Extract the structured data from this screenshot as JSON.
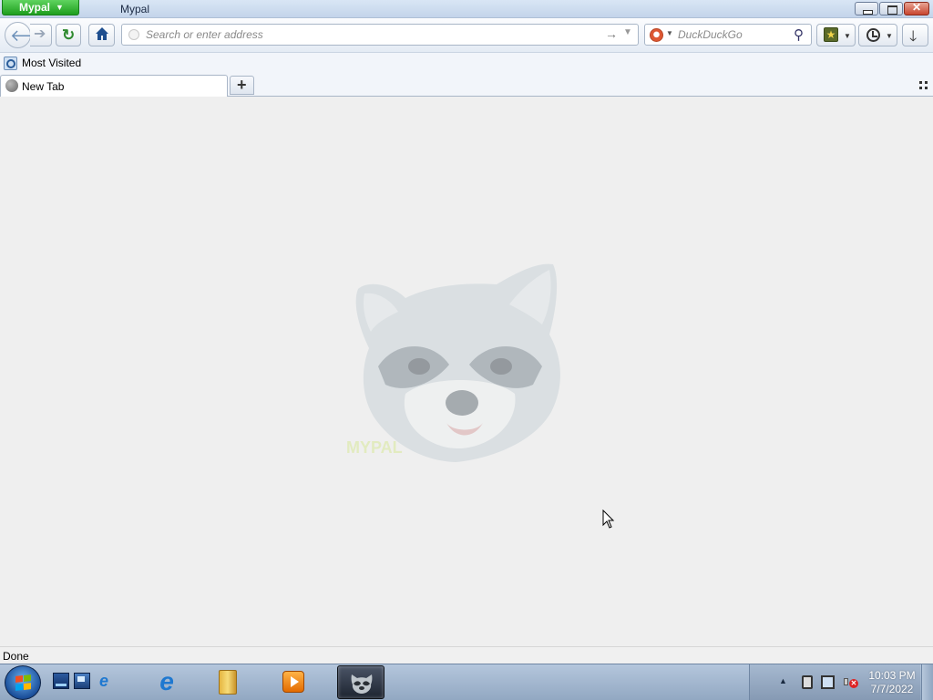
{
  "window": {
    "app_menu_label": "Mypal",
    "title": "Mypal",
    "close_glyph": "✕"
  },
  "navbar": {
    "url_placeholder": "Search or enter address",
    "url_value": "",
    "search_placeholder": "DuckDuckGo",
    "search_value": ""
  },
  "bookmarks_toolbar": {
    "items": [
      {
        "label": "Most Visited",
        "icon": "most-visited-icon"
      }
    ]
  },
  "tabs": [
    {
      "label": "New Tab",
      "icon": "globe-icon",
      "selected": true
    }
  ],
  "status": {
    "text": "Done"
  },
  "taskbar": {
    "pinned": [
      "internet-explorer",
      "windows-explorer",
      "media-player",
      "mypal"
    ],
    "active": "mypal",
    "clock_time": "10:03 PM",
    "clock_date": "7/7/2022"
  },
  "colors": {
    "app_menu": "#1e9e1e",
    "titlebar": "#c3d4ea",
    "content_bg": "#efefef",
    "taskbar": "#92a8c2"
  }
}
